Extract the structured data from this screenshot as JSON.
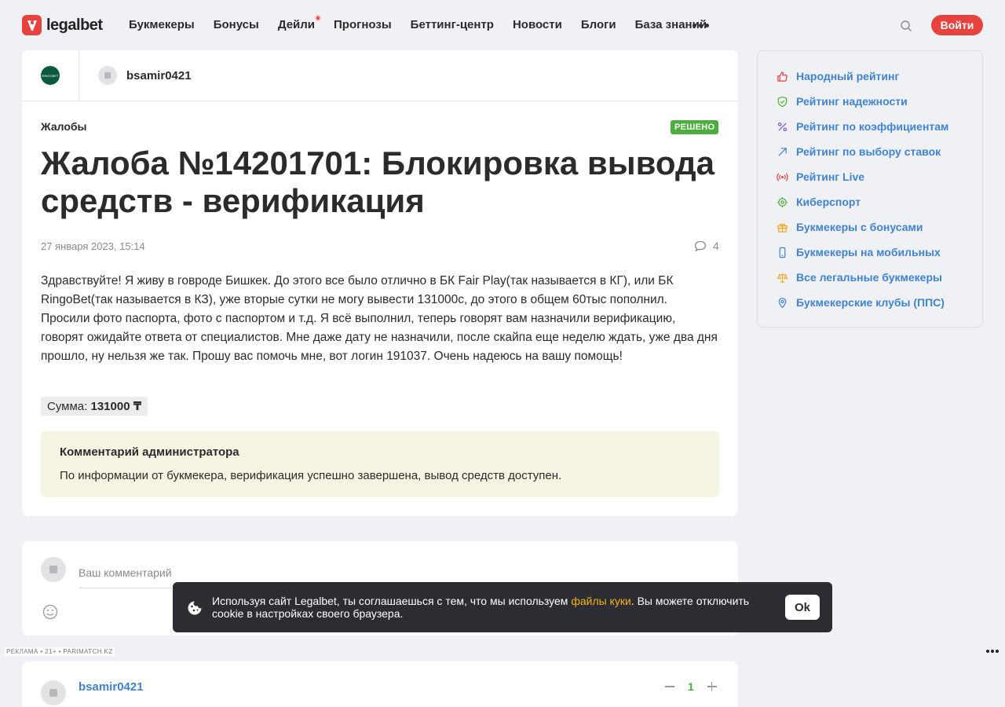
{
  "brand": {
    "name": "legalbet",
    "color": "#e8423f"
  },
  "nav": {
    "items": [
      "Букмекеры",
      "Бонусы",
      "Дейли",
      "Прогнозы",
      "Беттинг-центр",
      "Новости",
      "Блоги",
      "База знаний"
    ],
    "login_label": "Войти"
  },
  "complaint": {
    "bookmaker_logo_text": "RINGOBET",
    "author": "bsamir0421",
    "category": "Жалобы",
    "status": "РЕШЕНО",
    "title": "Жалоба №14201701: Блокировка вывода средств - верификация",
    "date": "27 января 2023, 15:14",
    "comments": "4",
    "body": "Здравствуйте! Я живу в говроде Бишкек. До этого все было отлично в БК Fair Play(так называется в КГ), или БК RingoBet(так называется в КЗ), уже вторые сутки не могу вывести 131000с, до этого в общем 60тыс пополнил. Просили фото паспорта, фото с паспортом и т.д. Я всё выполнил, теперь говорят вам назначили верификацию, говорят ожидайте ответа от специалистов. Мне даже дату не назначили, после скайпа еще неделю ждать, уже два дня прошло, ну нельзя же так. Прошу вас помочь мне, вот логин 191037. Очень надеюсь на вашу помощь!",
    "amount_label": "Сумма:",
    "amount_value": "131000 ₸",
    "admin_title": "Комментарий администратора",
    "admin_text": "По информации от букмекера, верификация успешно завершена, вывод средств доступен."
  },
  "sidebar": {
    "items": [
      {
        "label": "Народный рейтинг",
        "icon": "thumb-up-icon",
        "color": "#e8423f"
      },
      {
        "label": "Рейтинг надежности",
        "icon": "shield-check-icon",
        "color": "#4caf3d"
      },
      {
        "label": "Рейтинг по коэффициентам",
        "icon": "percent-icon",
        "color": "#7b5ad6"
      },
      {
        "label": "Рейтинг по выбору ставок",
        "icon": "arrow-up-right-icon",
        "color": "#3f83d6"
      },
      {
        "label": "Рейтинг Live",
        "icon": "broadcast-icon",
        "color": "#e8423f"
      },
      {
        "label": "Киберспорт",
        "icon": "target-icon",
        "color": "#4caf3d"
      },
      {
        "label": "Букмекеры с бонусами",
        "icon": "gift-icon",
        "color": "#f5a623"
      },
      {
        "label": "Букмекеры на мобильных",
        "icon": "mobile-icon",
        "color": "#3f83d6"
      },
      {
        "label": "Все легальные букмекеры",
        "icon": "scales-icon",
        "color": "#f5a623"
      },
      {
        "label": "Букмекерские клубы (ППС)",
        "icon": "location-pin-icon",
        "color": "#3f83d6"
      }
    ]
  },
  "comment_form": {
    "placeholder": "Ваш комментарий"
  },
  "ad": {
    "label": "РЕКЛАМА • 21+ • PARIMATCH.KZ"
  },
  "comment_entry": {
    "author": "bsamir0421",
    "votes": "1"
  },
  "cookie": {
    "text_before": "Используя сайт Legalbet, ты соглашаешься с тем, что мы используем ",
    "link": "файлы куки",
    "text_after": ". Вы можете отключить cookie в настройках своего браузера.",
    "ok_label": "Ok"
  }
}
